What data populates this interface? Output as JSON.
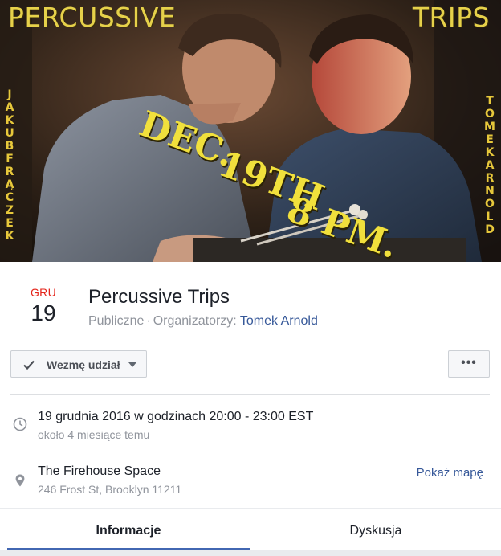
{
  "cover": {
    "poster_title_left": "PERCUSSIVE",
    "poster_title_right": "TRIPS",
    "performer_left": "JAKUBFRĄCZEK",
    "performer_right": "TOMEKARNOLD",
    "date_text": [
      "DEC.",
      "19TH",
      "8 PM."
    ]
  },
  "event": {
    "month": "GRU",
    "day": "19",
    "title": "Percussive Trips",
    "privacy": "Publiczne",
    "separator": "·",
    "organizers_label": "Organizatorzy:",
    "organizer": "Tomek Arnold"
  },
  "actions": {
    "going_label": "Wezmę udział",
    "more_label": "•••"
  },
  "details": {
    "time_main": "19 grudnia 2016 w godzinach 20:00 - 23:00 EST",
    "time_sub": "około 4 miesiące temu",
    "place_main": "The Firehouse Space",
    "place_sub": "246 Frost St, Brooklyn 11211",
    "map_link": "Pokaż mapę"
  },
  "tabs": [
    {
      "label": "Informacje",
      "active": true
    },
    {
      "label": "Dyskusja",
      "active": false
    }
  ],
  "colors": {
    "accent": "#4267b2",
    "link": "#365899",
    "month": "#e4251b",
    "poster_text": "#f1e03c"
  },
  "icons": {
    "going": "checkmark-icon",
    "dropdown": "caret-down-icon",
    "time": "clock-icon",
    "place": "map-pin-icon"
  }
}
